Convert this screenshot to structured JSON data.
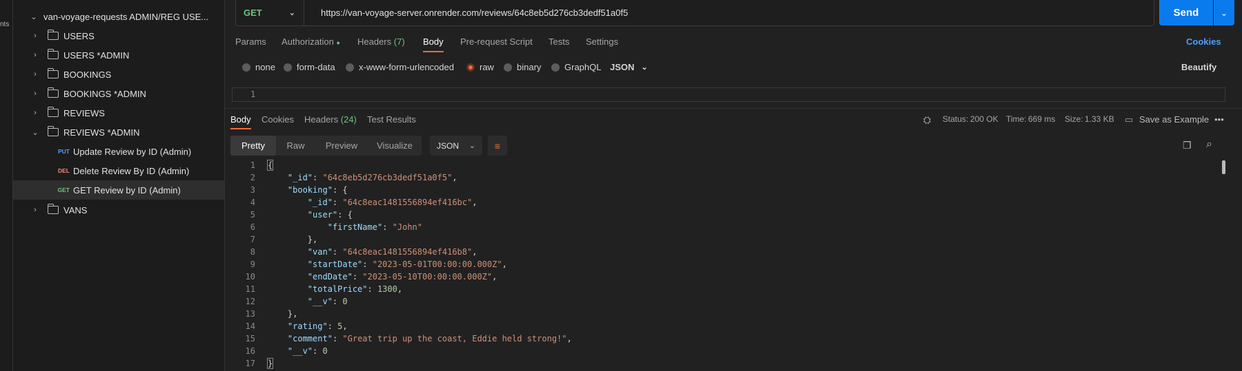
{
  "rail": {
    "label": "nts"
  },
  "sidebar": {
    "collection": "van-voyage-requests ADMIN/REG USE...",
    "folders": [
      {
        "label": "USERS",
        "expanded": false
      },
      {
        "label": "USERS *ADMIN",
        "expanded": false
      },
      {
        "label": "BOOKINGS",
        "expanded": false
      },
      {
        "label": "BOOKINGS *ADMIN",
        "expanded": false
      },
      {
        "label": "REVIEWS",
        "expanded": false
      },
      {
        "label": "REVIEWS *ADMIN",
        "expanded": true
      }
    ],
    "requests": [
      {
        "method": "PUT",
        "label": "Update Review by ID (Admin)",
        "color": "#4aa0ff"
      },
      {
        "method": "DEL",
        "label": "Delete Review By ID (Admin)",
        "color": "#f08b73"
      },
      {
        "method": "GET",
        "label": "GET Review by ID (Admin)",
        "color": "#6fc381",
        "selected": true
      }
    ],
    "last_folder": "VANS"
  },
  "request": {
    "method": "GET",
    "url": "https://van-voyage-server.onrender.com/reviews/64c8eb5d276cb3dedf51a0f5",
    "send_label": "Send"
  },
  "req_tabs": {
    "params": "Params",
    "authorization": "Authorization",
    "headers": "Headers",
    "headers_count": "(7)",
    "body": "Body",
    "pre_request": "Pre-request Script",
    "tests": "Tests",
    "settings": "Settings",
    "cookies": "Cookies"
  },
  "body_types": {
    "none": "none",
    "form_data": "form-data",
    "urlencoded": "x-www-form-urlencoded",
    "raw": "raw",
    "binary": "binary",
    "graphql": "GraphQL",
    "format": "JSON",
    "beautify": "Beautify"
  },
  "req_editor": {
    "line": "1"
  },
  "response": {
    "tabs": {
      "body": "Body",
      "cookies": "Cookies",
      "headers": "Headers",
      "headers_count": "(24)",
      "test_results": "Test Results"
    },
    "status_label": "Status:",
    "status_value": "200 OK",
    "time_label": "Time:",
    "time_value": "669 ms",
    "size_label": "Size:",
    "size_value": "1.33 KB",
    "save_example": "Save as Example",
    "views": [
      "Pretty",
      "Raw",
      "Preview",
      "Visualize"
    ],
    "format": "JSON"
  },
  "code_lines": [
    {
      "n": "1",
      "t": [
        [
          "p",
          "{"
        ]
      ]
    },
    {
      "n": "2",
      "t": [
        [
          "p",
          "    "
        ],
        [
          "k",
          "\"_id\""
        ],
        [
          "p",
          ": "
        ],
        [
          "s",
          "\"64c8eb5d276cb3dedf51a0f5\""
        ],
        [
          "p",
          ","
        ]
      ]
    },
    {
      "n": "3",
      "t": [
        [
          "p",
          "    "
        ],
        [
          "k",
          "\"booking\""
        ],
        [
          "p",
          ": {"
        ]
      ]
    },
    {
      "n": "4",
      "t": [
        [
          "p",
          "        "
        ],
        [
          "k",
          "\"_id\""
        ],
        [
          "p",
          ": "
        ],
        [
          "s",
          "\"64c8eac1481556894ef416bc\""
        ],
        [
          "p",
          ","
        ]
      ]
    },
    {
      "n": "5",
      "t": [
        [
          "p",
          "        "
        ],
        [
          "k",
          "\"user\""
        ],
        [
          "p",
          ": {"
        ]
      ]
    },
    {
      "n": "6",
      "t": [
        [
          "p",
          "            "
        ],
        [
          "k",
          "\"firstName\""
        ],
        [
          "p",
          ": "
        ],
        [
          "s",
          "\"John\""
        ]
      ]
    },
    {
      "n": "7",
      "t": [
        [
          "p",
          "        },"
        ]
      ]
    },
    {
      "n": "8",
      "t": [
        [
          "p",
          "        "
        ],
        [
          "k",
          "\"van\""
        ],
        [
          "p",
          ": "
        ],
        [
          "s",
          "\"64c8eac1481556894ef416b8\""
        ],
        [
          "p",
          ","
        ]
      ]
    },
    {
      "n": "9",
      "t": [
        [
          "p",
          "        "
        ],
        [
          "k",
          "\"startDate\""
        ],
        [
          "p",
          ": "
        ],
        [
          "s",
          "\"2023-05-01T00:00:00.000Z\""
        ],
        [
          "p",
          ","
        ]
      ]
    },
    {
      "n": "10",
      "t": [
        [
          "p",
          "        "
        ],
        [
          "k",
          "\"endDate\""
        ],
        [
          "p",
          ": "
        ],
        [
          "s",
          "\"2023-05-10T00:00:00.000Z\""
        ],
        [
          "p",
          ","
        ]
      ]
    },
    {
      "n": "11",
      "t": [
        [
          "p",
          "        "
        ],
        [
          "k",
          "\"totalPrice\""
        ],
        [
          "p",
          ": "
        ],
        [
          "n",
          "1300"
        ],
        [
          "p",
          ","
        ]
      ]
    },
    {
      "n": "12",
      "t": [
        [
          "p",
          "        "
        ],
        [
          "k",
          "\"__v\""
        ],
        [
          "p",
          ": "
        ],
        [
          "n",
          "0"
        ]
      ]
    },
    {
      "n": "13",
      "t": [
        [
          "p",
          "    },"
        ]
      ]
    },
    {
      "n": "14",
      "t": [
        [
          "p",
          "    "
        ],
        [
          "k",
          "\"rating\""
        ],
        [
          "p",
          ": "
        ],
        [
          "n",
          "5"
        ],
        [
          "p",
          ","
        ]
      ]
    },
    {
      "n": "15",
      "t": [
        [
          "p",
          "    "
        ],
        [
          "k",
          "\"comment\""
        ],
        [
          "p",
          ": "
        ],
        [
          "s",
          "\"Great trip up the coast, Eddie held strong!\""
        ],
        [
          "p",
          ","
        ]
      ]
    },
    {
      "n": "16",
      "t": [
        [
          "p",
          "    "
        ],
        [
          "k",
          "\"__v\""
        ],
        [
          "p",
          ": "
        ],
        [
          "n",
          "0"
        ]
      ]
    },
    {
      "n": "17",
      "t": [
        [
          "p",
          "}"
        ]
      ]
    }
  ],
  "colors": {
    "accent": "#f26b3a",
    "send": "#097bed",
    "get": "#6fc381"
  }
}
